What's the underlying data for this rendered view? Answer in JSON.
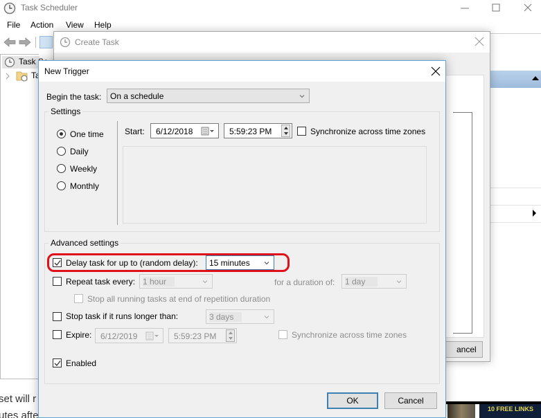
{
  "main_window": {
    "title": "Task Scheduler",
    "menu": [
      "File",
      "Action",
      "View",
      "Help"
    ],
    "tree": {
      "root": "Task Sc",
      "child": "Ta"
    },
    "background_text": [
      "set will r",
      "utes afte"
    ],
    "thumbnail_text": "10 FREE LINKS",
    "controls": {
      "minimize": "minimize-icon",
      "maximize": "maximize-icon",
      "close": "close-icon"
    }
  },
  "create_task": {
    "title": "Create Task",
    "cancel_label": "ancel"
  },
  "new_trigger": {
    "title": "New Trigger",
    "begin_label": "Begin the task:",
    "begin_value": "On a schedule",
    "settings": {
      "title": "Settings",
      "schedule_options": [
        {
          "label": "One time",
          "checked": true
        },
        {
          "label": "Daily",
          "checked": false
        },
        {
          "label": "Weekly",
          "checked": false
        },
        {
          "label": "Monthly",
          "checked": false
        }
      ],
      "start_label": "Start:",
      "start_date": "6/12/2018",
      "start_time": "5:59:23 PM",
      "sync_label": "Synchronize across time zones",
      "sync_checked": false
    },
    "advanced": {
      "title": "Advanced settings",
      "delay": {
        "label": "Delay task for up to (random delay):",
        "checked": true,
        "value": "15 minutes"
      },
      "repeat": {
        "label": "Repeat task every:",
        "checked": false,
        "value": "1 hour",
        "duration_label": "for a duration of:",
        "duration_value": "1 day"
      },
      "stop_repetition": {
        "label": "Stop all running tasks at end of repetition duration",
        "checked": false
      },
      "stop_longer": {
        "label": "Stop task if it runs longer than:",
        "checked": false,
        "value": "3 days"
      },
      "expire": {
        "label": "Expire:",
        "checked": false,
        "date": "6/12/2019",
        "time": "5:59:23 PM",
        "sync_label": "Synchronize across time zones"
      },
      "enabled": {
        "label": "Enabled",
        "checked": true
      }
    },
    "buttons": {
      "ok": "OK",
      "cancel": "Cancel"
    },
    "highlight_color": "#e0101a"
  }
}
